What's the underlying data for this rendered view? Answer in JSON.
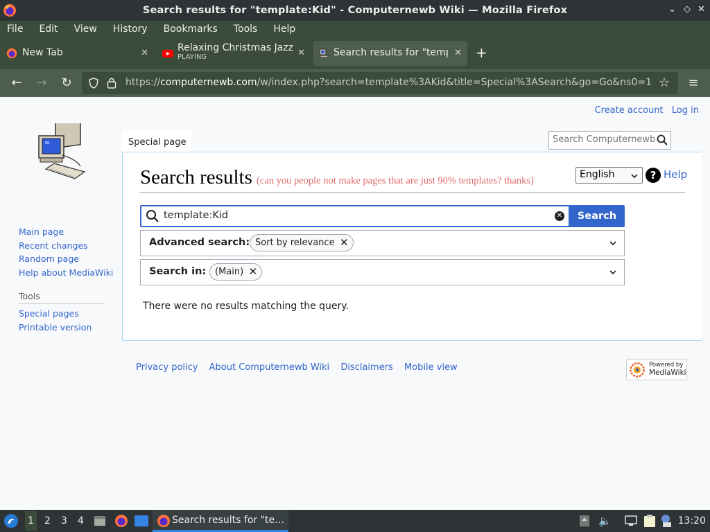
{
  "window": {
    "title": "Search results for \"template:Kid\" - Computernewb Wiki — Mozilla Firefox",
    "controls": [
      "⌄",
      "◇",
      "✕"
    ]
  },
  "menubar": [
    "File",
    "Edit",
    "View",
    "History",
    "Bookmarks",
    "Tools",
    "Help"
  ],
  "tabs": [
    {
      "label": "New Tab"
    },
    {
      "label": "Relaxing Christmas Jazz M",
      "sublabel": "PLAYING"
    },
    {
      "label": "Search results for \"templ"
    }
  ],
  "navbar": {
    "url_prefix": "https://",
    "url_domain": "computernewb.com",
    "url_rest": "/w/index.php?search=template%3AKid&title=Special%3ASearch&go=Go&ns0=1"
  },
  "page": {
    "personal": {
      "create_account": "Create account",
      "log_in": "Log in"
    },
    "content_tab": "Special page",
    "header_search_placeholder": "Search Computernewb Wiki",
    "heading": "Search results",
    "heading_note": "(can you people not make pages that are just 90% templates? thanks)",
    "language": "English",
    "help": "Help",
    "search_value": "template:Kid",
    "search_button": "Search",
    "advanced_label": "Advanced search:",
    "advanced_chip": "Sort by relevance",
    "searchin_label": "Search in:",
    "searchin_chip": "(Main)",
    "no_results": "There were no results matching the query."
  },
  "sidebar": {
    "nav": [
      "Main page",
      "Recent changes",
      "Random page",
      "Help about MediaWiki"
    ],
    "tools_heading": "Tools",
    "tools": [
      "Special pages",
      "Printable version"
    ]
  },
  "footer": {
    "links": [
      "Privacy policy",
      "About Computernewb Wiki",
      "Disclaimers",
      "Mobile view"
    ],
    "powered_top": "Powered by",
    "powered_bottom": "MediaWiki"
  },
  "taskbar": {
    "workspaces": [
      "1",
      "2",
      "3",
      "4"
    ],
    "task_label": "Search results for \"te…",
    "clock": "13:20"
  },
  "colors": {
    "link": "#3366cc",
    "accent": "#3366cc",
    "chrome_dark": "#2e3436",
    "chrome_green": "#3b4c3b",
    "heading_note": "#e06a6a"
  }
}
